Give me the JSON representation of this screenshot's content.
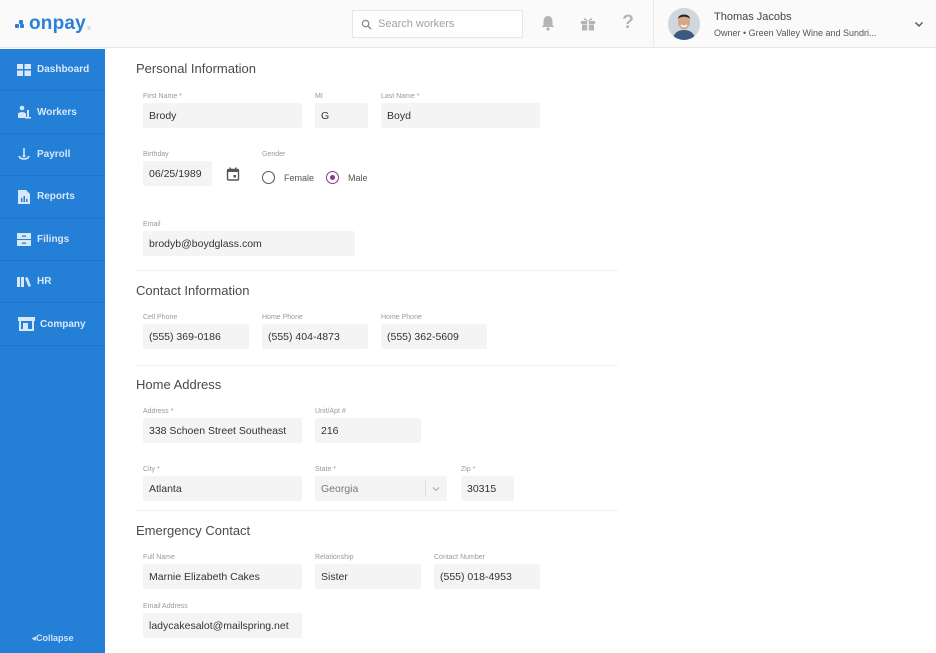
{
  "header": {
    "logo_text": "onpay",
    "logo_reg": "®",
    "search_placeholder": "Search workers",
    "user": {
      "name": "Thomas Jacobs",
      "role": "Owner • Green Valley Wine and Sundri..."
    }
  },
  "sidebar": {
    "items": [
      {
        "label": "Dashboard",
        "icon": "dashboard-icon"
      },
      {
        "label": "Workers",
        "icon": "workers-icon"
      },
      {
        "label": "Payroll",
        "icon": "payroll-icon"
      },
      {
        "label": "Reports",
        "icon": "reports-icon"
      },
      {
        "label": "Filings",
        "icon": "filings-icon"
      },
      {
        "label": "HR",
        "icon": "hr-icon"
      },
      {
        "label": "Company",
        "icon": "company-icon"
      }
    ],
    "collapse_label": "◂Collapse"
  },
  "colors": {
    "brand": "#2b7fd6",
    "sidebar": "#2480d6",
    "radio_accent": "#8b3a8f"
  },
  "personal": {
    "title": "Personal Information",
    "first_name": {
      "label": "First Name *",
      "value": "Brody"
    },
    "mi": {
      "label": "MI",
      "value": "G"
    },
    "last_name": {
      "label": "Last Name *",
      "value": "Boyd"
    },
    "birthday": {
      "label": "Birthday",
      "value": "06/25/1989"
    },
    "gender": {
      "label": "Gender",
      "options": [
        "Female",
        "Male"
      ],
      "selected": "Male"
    },
    "email": {
      "label": "Email",
      "value": "brodyb@boydglass.com"
    }
  },
  "contact": {
    "title": "Contact Information",
    "cell": {
      "label": "Cell Phone",
      "value": "(555) 369-0186"
    },
    "home1": {
      "label": "Home Phone",
      "value": "(555) 404-4873"
    },
    "home2": {
      "label": "Home Phone",
      "value": "(555) 362-5609"
    }
  },
  "address": {
    "title": "Home Address",
    "street": {
      "label": "Address *",
      "value": "338 Schoen Street Southeast"
    },
    "unit": {
      "label": "Unit/Apt #",
      "value": "216"
    },
    "city": {
      "label": "City *",
      "value": "Atlanta"
    },
    "state": {
      "label": "State *",
      "value": "Georgia"
    },
    "zip": {
      "label": "Zip *",
      "value": "30315"
    }
  },
  "emergency": {
    "title": "Emergency Contact",
    "full_name": {
      "label": "Full Name",
      "value": "Marnie Elizabeth Cakes"
    },
    "relationship": {
      "label": "Relationship",
      "value": "Sister"
    },
    "number": {
      "label": "Contact Number",
      "value": "(555) 018-4953"
    },
    "email": {
      "label": "Email Address",
      "value": "ladycakesalot@mailspring.net"
    }
  }
}
